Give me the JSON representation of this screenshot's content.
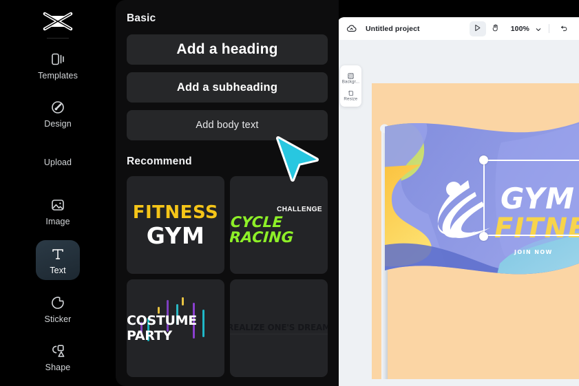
{
  "app": {
    "logo_icon": "capcut-logo-icon",
    "accent_cyan": "#28c7e0",
    "panel_bg": "#0d0d0e",
    "rail_bg": "#000000"
  },
  "sidebar": {
    "items": [
      {
        "label": "Templates",
        "icon": "templates-icon",
        "active": false
      },
      {
        "label": "Design",
        "icon": "design-brush-icon",
        "active": false
      },
      {
        "label": "Upload",
        "icon": "upload-icon",
        "active": false
      },
      {
        "label": "Image",
        "icon": "image-icon",
        "active": false
      },
      {
        "label": "Text",
        "icon": "text-t-icon",
        "active": true
      },
      {
        "label": "Sticker",
        "icon": "sticker-icon",
        "active": false
      },
      {
        "label": "Shape",
        "icon": "shape-icon",
        "active": false
      }
    ]
  },
  "panel": {
    "basic_title": "Basic",
    "buttons": [
      {
        "label": "Add a heading"
      },
      {
        "label": "Add a subheading"
      },
      {
        "label": "Add body text"
      }
    ],
    "recommend_title": "Recommend",
    "templates": [
      {
        "id": "fitness-gym",
        "line1": "FITNESS",
        "line2": "GYM",
        "color1": "#f5c518",
        "color2": "#ffffff",
        "bg": "#232427"
      },
      {
        "id": "cycle-racing",
        "line1": "CHALLENGE",
        "line2": "CYCLE RACING",
        "color1": "#ffffff",
        "color2": "#8ef028",
        "bg": "#232427"
      },
      {
        "id": "costume-party",
        "line1": "COSTUME PARTY",
        "line2": "",
        "color1": "#ffffff",
        "color2": "#ffffff",
        "bg": "#232427"
      },
      {
        "id": "realize-one-dream",
        "line1": "REALIZE ONE'S DREAM",
        "line2": "",
        "color1": "#15161a",
        "color2": "#c4161c",
        "bg": "#232427"
      }
    ]
  },
  "editor": {
    "topbar": {
      "cloud_icon": "cloud-save-icon",
      "project_name": "Untitled project",
      "select_tool_icon": "cursor-select-icon",
      "hand_tool_icon": "hand-pan-icon",
      "zoom_level": "100%",
      "zoom_chevron_icon": "chevron-down-icon",
      "undo_icon": "undo-arrow-icon"
    },
    "mini_tools": [
      {
        "label": "Backgr...",
        "icon": "background-checker-icon"
      },
      {
        "label": "Resize",
        "icon": "resize-frame-icon"
      }
    ],
    "canvas": {
      "background": "#eef1f4",
      "artboard_bg": "#fbd5a4",
      "flag": {
        "pole_color": "#dfe4ea",
        "band_purple": "#7d87d8",
        "band_periwinkle": "#8e9ae8",
        "band_lavender": "#9aa3ea",
        "band_indigo": "#5d6ecb",
        "band_yellow": "#fbc23f",
        "band_yellow_light": "#fcd96a",
        "band_green": "#b9d35e",
        "band_blue": "#7cc5e3"
      },
      "artwork_text": {
        "title_line1": "GYM",
        "title_line2": "FITNESS",
        "subtitle": "JOIN NOW",
        "title1_color": "#ffffff",
        "title2_color": "#f7d44c",
        "subtitle_color": "#ffffff"
      },
      "selection": {
        "handles": 2,
        "handle_color": "#ffffff"
      }
    }
  },
  "cursor": {
    "icon": "arrow-pointer-icon",
    "fill": "#28c7e0",
    "stroke": "#ffffff"
  }
}
